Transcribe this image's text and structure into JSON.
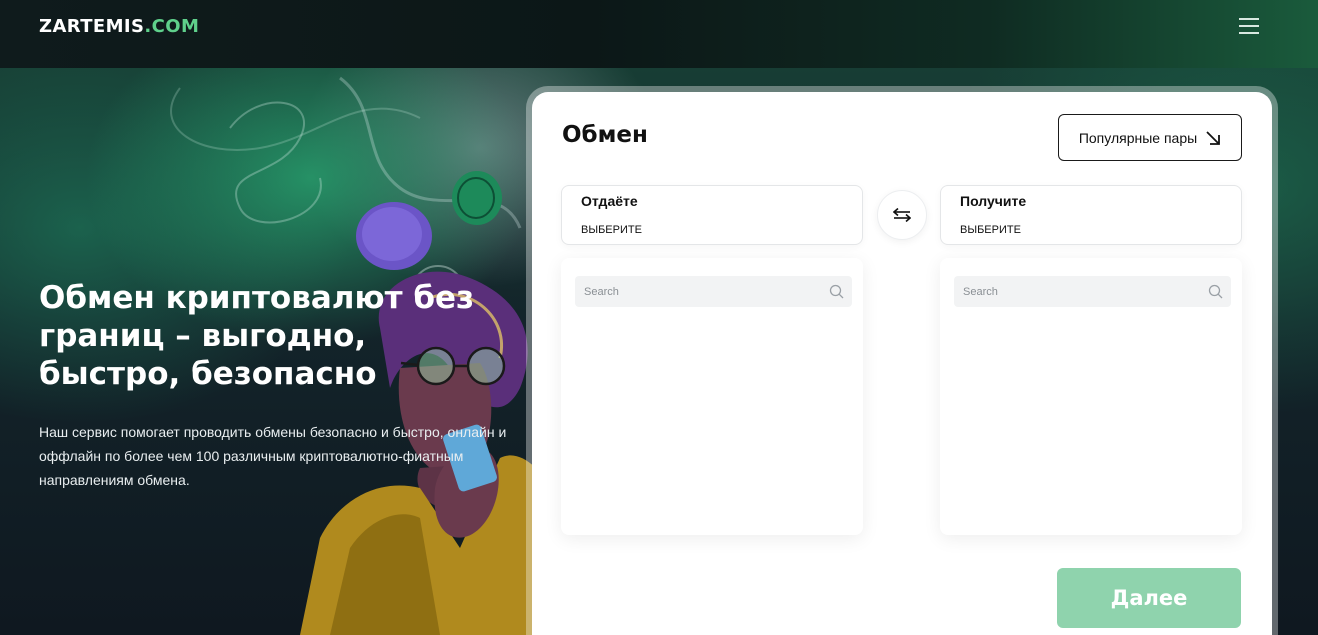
{
  "header": {
    "logo_main": "ZARTEMIS",
    "logo_tld": ".COM",
    "menu_icon": "hamburger-menu-icon"
  },
  "hero": {
    "title": "Обмен криптовалют без границ – выгодно, быстро, безопасно",
    "description": "Наш сервис помогает проводить обмены безопасно и быстро, онлайн и оффлайн по более чем 100 различным криптовалютно-фиатным направлениям обмена."
  },
  "exchange": {
    "title": "Обмен",
    "popular_pairs_label": "Популярные пары",
    "popular_pairs_icon": "arrow-down-right-icon",
    "give": {
      "label": "Отдаёте",
      "value": "ВЫБЕРИТЕ",
      "search_placeholder": "Search"
    },
    "get": {
      "label": "Получите",
      "value": "ВЫБЕРИТЕ",
      "search_placeholder": "Search"
    },
    "swap_icon": "swap-arrows-icon",
    "next_label": "Далее"
  },
  "colors": {
    "accent": "#5fd08b",
    "next_button": "#8fd3ad",
    "text_dark": "#111111"
  }
}
